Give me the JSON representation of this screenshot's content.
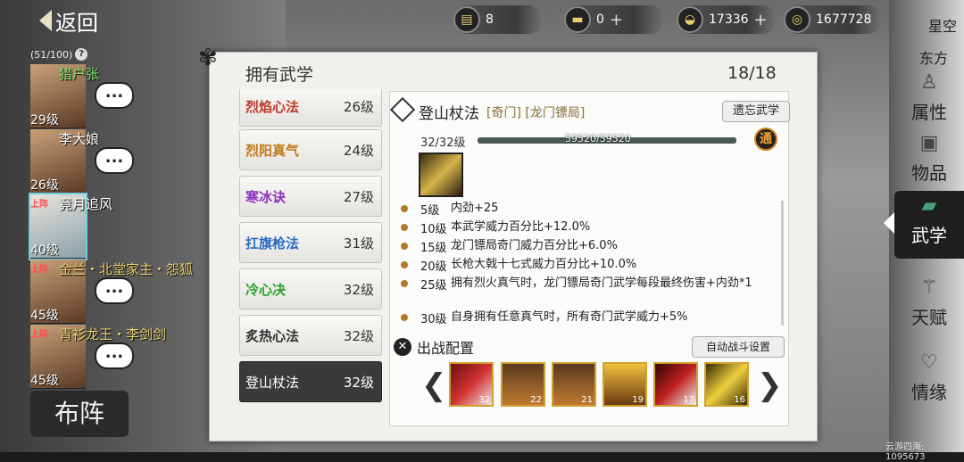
{
  "nav": {
    "back_label": "返回",
    "capacity": "(51/100)",
    "help": "?"
  },
  "roster": [
    {
      "name": "猎户张",
      "level": "29级",
      "on_team": "",
      "name_style": "green"
    },
    {
      "name": "李大娘",
      "level": "26级",
      "on_team": "",
      "name_style": "white"
    },
    {
      "name": "竟月追风",
      "level": "40级",
      "on_team": "上阵",
      "name_style": "white"
    },
    {
      "name": "金兰・北堂家主・怨狐",
      "level": "45级",
      "on_team": "上阵",
      "name_style": "gold"
    },
    {
      "name": "青衫龙王・李剑剑",
      "level": "45级",
      "on_team": "上阵",
      "name_style": "gold"
    }
  ],
  "bubble": "...",
  "formation_label": "布阵",
  "resources": [
    {
      "icon": "scroll-icon",
      "value": "8",
      "plus": ""
    },
    {
      "icon": "gold-bar-icon",
      "value": "0",
      "plus": "+"
    },
    {
      "icon": "silver-ingot-icon",
      "value": "17336",
      "plus": "+"
    },
    {
      "icon": "coin-icon",
      "value": "1677728",
      "plus": ""
    }
  ],
  "panel": {
    "title": "拥有武学",
    "count": "18/18"
  },
  "skills": [
    {
      "name": "烈焰心法",
      "level": "26级",
      "color": "#c0392b"
    },
    {
      "name": "烈阳真气",
      "level": "24级",
      "color": "#c07a1a"
    },
    {
      "name": "寒冰诀",
      "level": "27级",
      "color": "#8e2fbf"
    },
    {
      "name": "扛旗枪法",
      "level": "31级",
      "color": "#2b6cc0"
    },
    {
      "name": "冷心决",
      "level": "32级",
      "color": "#2aa02a"
    },
    {
      "name": "炙热心法",
      "level": "32级",
      "color": "#333333"
    },
    {
      "name": "登山杖法",
      "level": "32级",
      "color": "#ffffff"
    }
  ],
  "detail": {
    "title": "登山杖法",
    "tags": "[奇门] [龙门镖局]",
    "forget_label": "遗忘武学",
    "level": "32/32级",
    "xp": "59520/59520",
    "xp_fraction": 1.0,
    "badge": "通",
    "effects": [
      {
        "lv": "5级",
        "text": "内劲+25"
      },
      {
        "lv": "10级",
        "text": "本武学威力百分比+12.0%"
      },
      {
        "lv": "15级",
        "text": "龙门镖局奇门威力百分比+6.0%"
      },
      {
        "lv": "20级",
        "text": "长枪大戟十七式威力百分比+10.0%"
      },
      {
        "lv": "25级",
        "text": "拥有烈火真气时，龙门镖局奇门武学每段最终伤害+内劲*1"
      },
      {
        "lv": "30级",
        "text": "自身拥有任意真气时，所有奇门武学威力+5%"
      }
    ],
    "combat_label": "出战配置",
    "auto_label": "自动战斗设置",
    "slots": [
      "32",
      "22",
      "21",
      "19",
      "17",
      "16"
    ]
  },
  "side": {
    "top": "星空",
    "sub": "东方",
    "menu": [
      {
        "label": "属性",
        "icon": "person-icon",
        "active": false
      },
      {
        "label": "物品",
        "icon": "box-icon",
        "active": false
      },
      {
        "label": "武学",
        "icon": "book-icon",
        "active": true
      },
      {
        "label": "天赋",
        "icon": "branch-icon",
        "active": false
      },
      {
        "label": "情缘",
        "icon": "heart-icon",
        "active": false
      }
    ],
    "watermark": "云游四海: 1095673"
  }
}
